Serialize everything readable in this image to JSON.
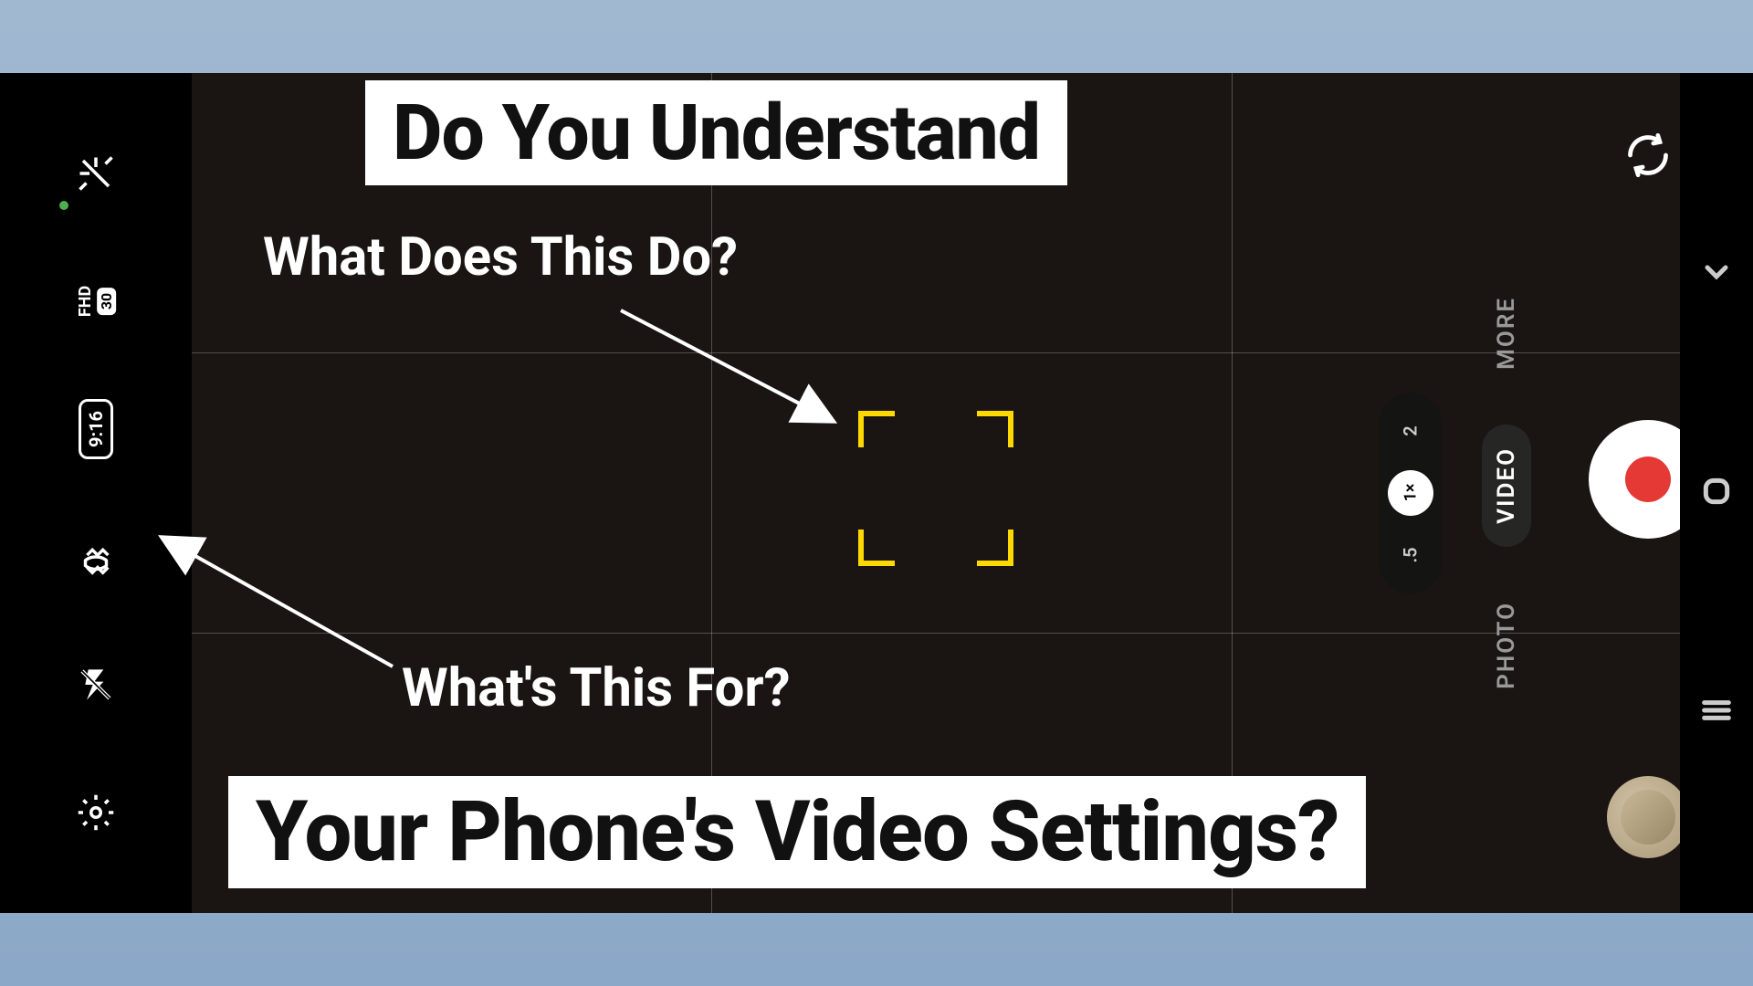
{
  "headline": {
    "top": "Do You Understand",
    "bottom": "Your Phone's Video Settings?"
  },
  "annotations": {
    "focus_question": "What Does This Do?",
    "stabilizer_question": "What's This For?"
  },
  "sidebar": {
    "resolution_label": "FHD",
    "framerate_label": "30",
    "aspect_ratio": "9:16"
  },
  "zoom": {
    "options": [
      ".5",
      "1",
      "2"
    ],
    "active_label": "1×",
    "active_index": 1
  },
  "modes": {
    "items": [
      "PHOTO",
      "VIDEO",
      "MORE"
    ],
    "active_index": 1
  },
  "colors": {
    "focus_box": "#ffd800",
    "record": "#e53935"
  }
}
